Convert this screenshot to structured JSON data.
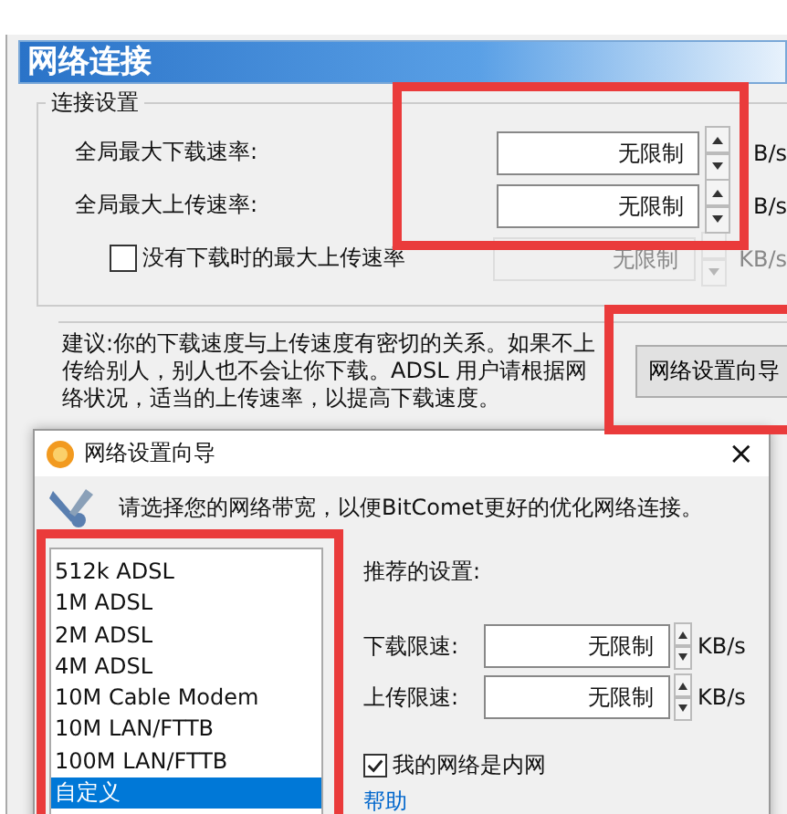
{
  "panel": {
    "title": "网络连接",
    "group_title": "连接设置",
    "rows": [
      {
        "kind": "field",
        "label": "全局最大下载速率:",
        "value": "无限制",
        "unit": "B/s",
        "disabled": false
      },
      {
        "kind": "field",
        "label": "全局最大上传速率:",
        "value": "无限制",
        "unit": "B/s",
        "disabled": false
      },
      {
        "kind": "checkbox",
        "label": "没有下载时的最大上传速率",
        "checked": false,
        "value": "无限制",
        "unit": "KB/s",
        "disabled": true
      }
    ],
    "advice": "建议:你的下载速度与上传速度有密切的关系。如果不上传给别人，别人也不会让你下载。ADSL 用户请根据网络状况，适当的上传速率，以提高下载速度。",
    "wizard_button": "网络设置向导"
  },
  "dialog": {
    "title": "网络设置向导",
    "close": "×",
    "intro": "请选择您的网络带宽，以便BitComet更好的优化网络连接。",
    "bandwidths": [
      {
        "label": "512k ADSL",
        "selected": false
      },
      {
        "label": "1M ADSL",
        "selected": false
      },
      {
        "label": "2M ADSL",
        "selected": false
      },
      {
        "label": "4M ADSL",
        "selected": false
      },
      {
        "label": "10M Cable Modem",
        "selected": false
      },
      {
        "label": "10M LAN/FTTB",
        "selected": false
      },
      {
        "label": "100M LAN/FTTB",
        "selected": false
      },
      {
        "label": "自定义",
        "selected": true
      }
    ],
    "recommended_title": "推荐的设置:",
    "limits": [
      {
        "label": "下载限速:",
        "value": "无限制",
        "unit": "KB/s"
      },
      {
        "label": "上传限速:",
        "value": "无限制",
        "unit": "KB/s"
      }
    ],
    "lan_checkbox": {
      "label": "我的网络是内网",
      "checked": true
    },
    "help_link": "帮助"
  }
}
